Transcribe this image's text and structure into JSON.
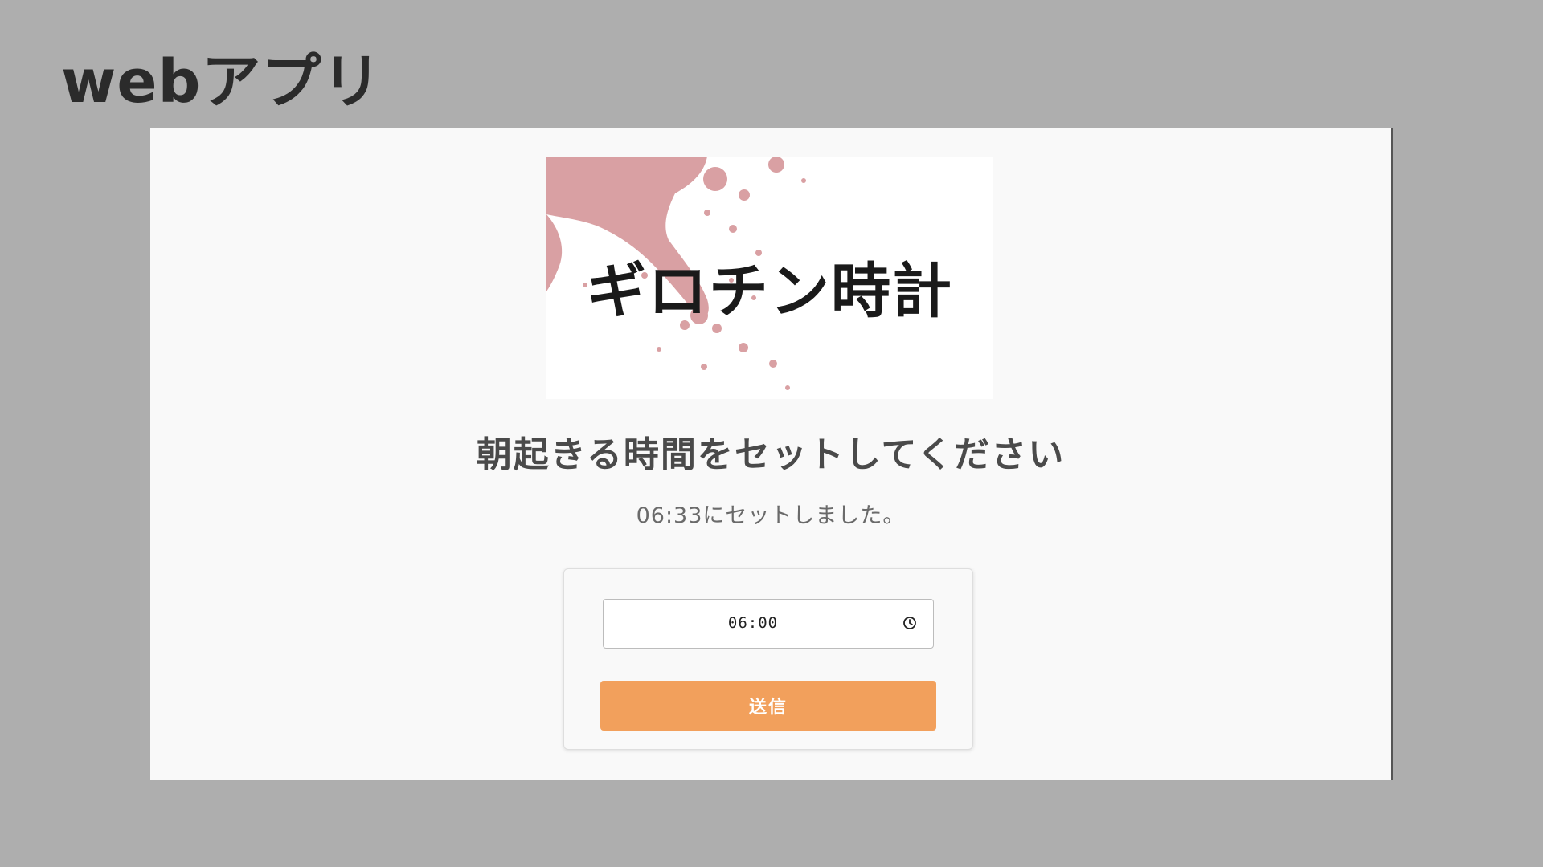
{
  "slide": {
    "title": "webアプリ"
  },
  "app": {
    "logo": {
      "text": "ギロチン時計",
      "splatter_color": "#d9a0a3"
    },
    "heading": "朝起きる時間をセットしてください",
    "status_message": "06:33にセットしました。",
    "form": {
      "time_value": "06:00",
      "submit_label": "送信",
      "submit_color": "#f2a05c",
      "clock_icon": "clock-icon"
    }
  }
}
